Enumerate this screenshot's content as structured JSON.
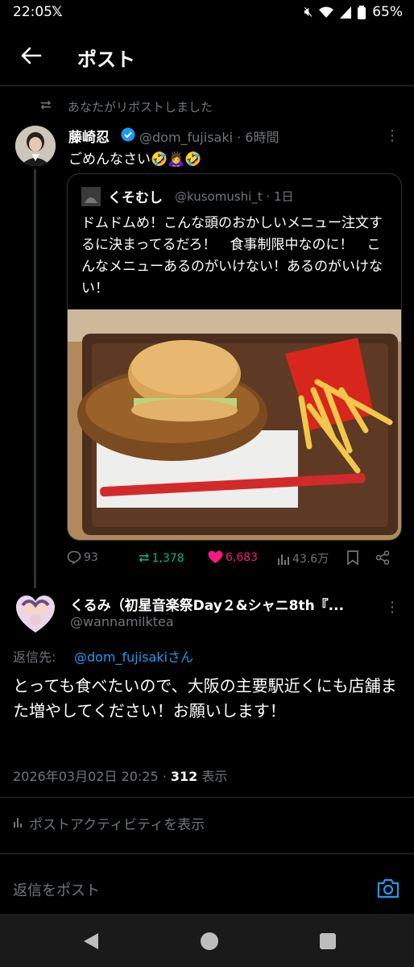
{
  "status_bar": {
    "time": "22:05",
    "app_logo": "𝕏",
    "battery": "65%"
  },
  "header": {
    "title": "ポスト"
  },
  "repost_notice": "あなたがリポストしました",
  "post": {
    "name": "藤崎忍",
    "handle_time": "@dom_fujisaki · 6時間",
    "body": "ごめんなさい🤣🙇‍♀️🤣"
  },
  "quote": {
    "name": "くそむし",
    "handle_time": "@kusomushi_t · 1日",
    "body": "ドムドムめ！こんな頭のおかしいメニュー注文するに決まってるだろ！　食事制限中なのに！　こんなメニューあるのがいけない！あるのがいけない！"
  },
  "actions": {
    "replies": "93",
    "reposts": "1,378",
    "likes": "6,683",
    "views": "43.6万"
  },
  "reply": {
    "name": "くるみ（初星音楽祭Day２&シャニ8th『...",
    "handle": "@wannamilktea",
    "reply_to_label": "返信先:",
    "reply_to_user": "@dom_fujisakiさん",
    "body": "とっても食べたいので、大阪の主要駅近くにも店舗また増やしてください！お願いします！",
    "timestamp": "2026年03月02日 20:25 · ",
    "view_count": "312",
    "view_suffix": " 表示",
    "activity_label": "ポストアクティビティを表示"
  },
  "compose": {
    "placeholder": "返信をポスト"
  },
  "colors": {
    "accent": "#1d9bf0",
    "retweet": "#00ba7c",
    "like": "#f91880",
    "muted": "#71767b"
  }
}
